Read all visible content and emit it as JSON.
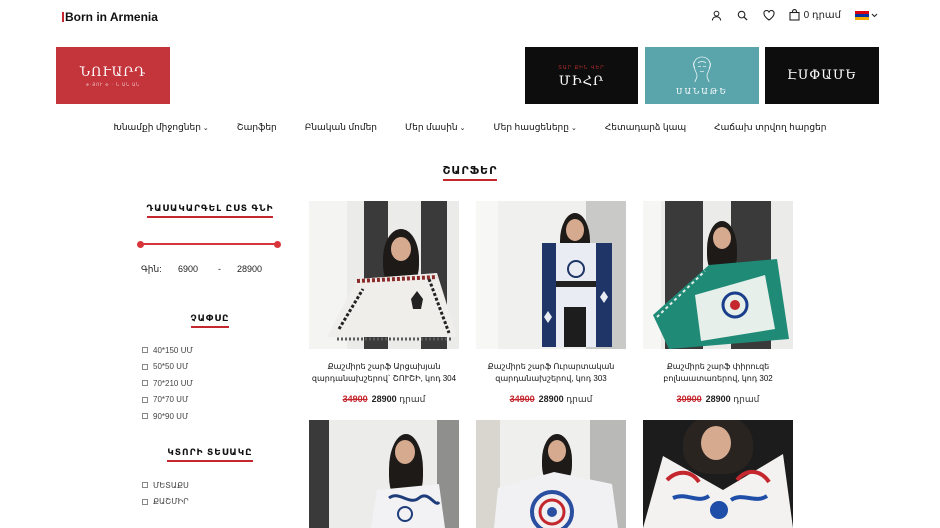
{
  "header": {
    "logo_text": "Born in Armenia",
    "cart_price": "0 դրամ",
    "icons": [
      "user-icon",
      "search-icon",
      "heart-icon",
      "cart-icon",
      "chevron-down-icon"
    ]
  },
  "brands": [
    {
      "name": "ՆՈՒԱՐԴ",
      "sub": "Ф·ՅՈՒ Ф · Ն ԱՆ ԱՆ"
    },
    {
      "name": "ՄԻՀՐ",
      "sub": "ՏԱՐ ՔԻՆ ՎԵՐ"
    },
    {
      "name": "ՍԱՆԱԹԵ",
      "sub": ""
    },
    {
      "name": "ԷՍՓԱՄԵ",
      "sub": ""
    }
  ],
  "nav": [
    {
      "label": "Խնամքի միջոցներ",
      "dropdown": true
    },
    {
      "label": "Շարֆեր",
      "dropdown": false
    },
    {
      "label": "Բնական մոմեր",
      "dropdown": false
    },
    {
      "label": "Մեր մասին",
      "dropdown": true
    },
    {
      "label": "Մեր հասցեները",
      "dropdown": true
    },
    {
      "label": "Հետադարձ կապ",
      "dropdown": false
    },
    {
      "label": "Հաճախ տրվող հարցեր",
      "dropdown": false
    }
  ],
  "section_title": "ՇԱՐՖԵՐ",
  "sidebar": {
    "sort_title": "ԴԱՍԱԿԱՐԳԵԼ ԸՍՏ ԳՆԻ",
    "price_label": "Գին:",
    "price_min": "6900",
    "price_sep": "-",
    "price_max": "28900",
    "size_title": "ՉԱՓՍԸ",
    "sizes": [
      "40*150 ՍՄ",
      "50*50 ՍՄ",
      "70*210 ՍՄ",
      "70*70 ՍՄ",
      "90*90 ՍՄ"
    ],
    "cut_title": "ԿՏՈՐԻ ՏԵՍԱԿԸ",
    "cuts": [
      "ՄԵՏԱՔՍ",
      "ՔԱՇՄԻՐ"
    ]
  },
  "products": [
    {
      "title": "Քաշմիրե շարֆ Արցախյան զարդանախշերով` ՇՈՒՇԻ, կոդ 304",
      "old_price": "34900",
      "price": "28900",
      "unit": "դրամ"
    },
    {
      "title": "Քաշմիրե շարֆ Ուրարտական զարդանախշերով, կոդ 303",
      "old_price": "34900",
      "price": "28900",
      "unit": "դրամ"
    },
    {
      "title": "Քաշմիրե շարֆ փիրուզե բոլնաատառերով, կոդ 302",
      "old_price": "30900",
      "price": "28900",
      "unit": "դրամ"
    },
    {
      "title": "",
      "old_price": "",
      "price": "",
      "unit": ""
    },
    {
      "title": "",
      "old_price": "",
      "price": "",
      "unit": ""
    },
    {
      "title": "",
      "old_price": "",
      "price": "",
      "unit": ""
    }
  ],
  "colors": {
    "accent": "#c4272e",
    "brand1": "#c3343b",
    "brand3": "#5aa5ac",
    "dark": "#0d0d0d"
  }
}
